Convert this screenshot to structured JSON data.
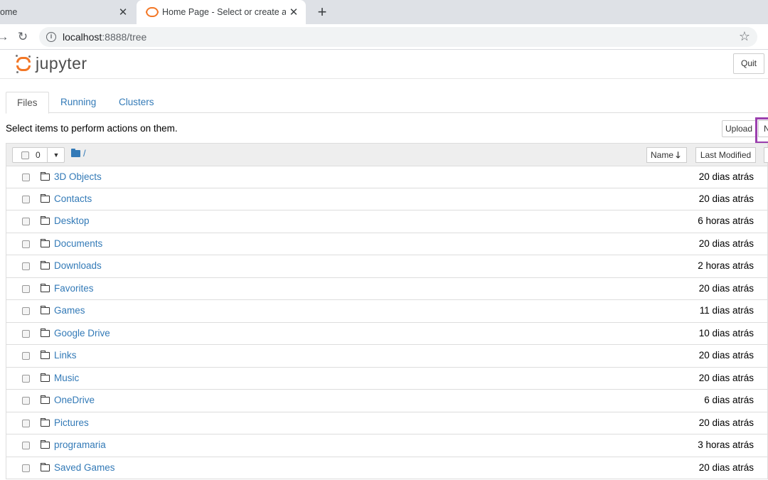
{
  "browser": {
    "inactive_tab_title": "ome",
    "active_tab_title": "Home Page - Select or create a n",
    "url_host": "localhost",
    "url_rest": ":8888/tree"
  },
  "jupyter": {
    "logo_text": "jupyter",
    "quit_label": "Quit"
  },
  "tabs": [
    {
      "label": "Files"
    },
    {
      "label": "Running"
    },
    {
      "label": "Clusters"
    }
  ],
  "hint": "Select items to perform actions on them.",
  "actions": {
    "upload_label": "Upload",
    "new_label": "N"
  },
  "list_header": {
    "selected_count": "0",
    "breadcrumb": "/",
    "sort_name_label": "Name",
    "sort_modified_label": "Last Modified"
  },
  "files": [
    {
      "name": "3D Objects",
      "modified": "20 dias atrás"
    },
    {
      "name": "Contacts",
      "modified": "20 dias atrás"
    },
    {
      "name": "Desktop",
      "modified": "6 horas atrás"
    },
    {
      "name": "Documents",
      "modified": "20 dias atrás"
    },
    {
      "name": "Downloads",
      "modified": "2 horas atrás"
    },
    {
      "name": "Favorites",
      "modified": "20 dias atrás"
    },
    {
      "name": "Games",
      "modified": "11 dias atrás"
    },
    {
      "name": "Google Drive",
      "modified": "10 dias atrás"
    },
    {
      "name": "Links",
      "modified": "20 dias atrás"
    },
    {
      "name": "Music",
      "modified": "20 dias atrás"
    },
    {
      "name": "OneDrive",
      "modified": "6 dias atrás"
    },
    {
      "name": "Pictures",
      "modified": "20 dias atrás"
    },
    {
      "name": "programaria",
      "modified": "3 horas atrás"
    },
    {
      "name": "Saved Games",
      "modified": "20 dias atrás"
    }
  ],
  "colors": {
    "link": "#337ab7",
    "jupyter_orange": "#f37726",
    "highlight": "#9b3fae"
  }
}
